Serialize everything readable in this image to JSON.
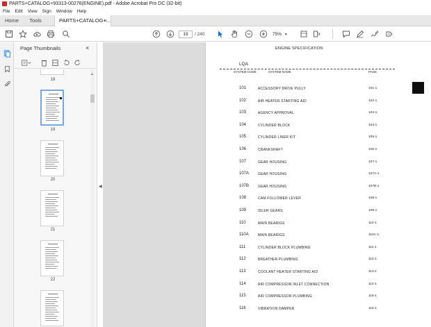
{
  "window": {
    "title": "PARTS+CATALOG+93313-00276(ENGINE).pdf - Adobe Acrobat Pro DC (32-bit)"
  },
  "menu": [
    "File",
    "Edit",
    "View",
    "Sign",
    "Window",
    "Help"
  ],
  "tabs": {
    "home": "Home",
    "tools": "Tools",
    "document": "PARTS+CATALOG+...",
    "close": "×"
  },
  "toolbar": {
    "page_current": "19",
    "page_total": "/ 240",
    "zoom": "75%"
  },
  "panel": {
    "title": "Page Thumbnails",
    "close": "×"
  },
  "thumbnails": [
    {
      "label": "18"
    },
    {
      "label": "19",
      "selected": true
    },
    {
      "label": "20"
    },
    {
      "label": "21"
    },
    {
      "label": "22"
    },
    {
      "label": ""
    }
  ],
  "document": {
    "heading": "ENGINE SPECIFICATION",
    "subheading": "LQA",
    "columns": {
      "code": "SYSTEM CODE",
      "name": "SYSTEM NAME",
      "page": "PAGE"
    },
    "rows": [
      {
        "code": "101",
        "name": "ACCESSORY DRIVE PULLY",
        "page": "101-1"
      },
      {
        "code": "102",
        "name": "AIR HEATER STARTING AID",
        "page": "102-1"
      },
      {
        "code": "103",
        "name": "AGENCY APPROVAL",
        "page": "103-1"
      },
      {
        "code": "104",
        "name": "CYLINDER BLOCK",
        "page": "104-1"
      },
      {
        "code": "105",
        "name": "CYLINDER LINER KIT",
        "page": "105-1"
      },
      {
        "code": "106",
        "name": "CRANKSHAFT",
        "page": "106-1"
      },
      {
        "code": "107",
        "name": "GEAR HOUSING",
        "page": "107-1"
      },
      {
        "code": "107A",
        "name": "GEAR HOUSING",
        "page": "107A-1"
      },
      {
        "code": "107B",
        "name": "GEAR HOUSING",
        "page": "107B-1"
      },
      {
        "code": "108",
        "name": "CAM FOLLOWER LEVER",
        "page": "108-1"
      },
      {
        "code": "109",
        "name": "IDLER GEARS",
        "page": "109-1"
      },
      {
        "code": "110",
        "name": "MAIN BEARIGS",
        "page": "110-1"
      },
      {
        "code": "110A",
        "name": "MAIN BEARIGS",
        "page": "110A-1"
      },
      {
        "code": "111",
        "name": "CYLINDER BLOCK PLUMBING",
        "page": "111-1"
      },
      {
        "code": "112",
        "name": "BREATHER PLUMBING",
        "page": "112-1"
      },
      {
        "code": "113",
        "name": "COOLANT HEATER STARTING AID",
        "page": "113-1"
      },
      {
        "code": "114",
        "name": "AIR COMPRESSOR INLET CONNECTION",
        "page": "114-1"
      },
      {
        "code": "115",
        "name": "AIR COMPRESSOR PLUMBING",
        "page": "115-1"
      },
      {
        "code": "116",
        "name": "VIBRATION DAMPER",
        "page": "116-1"
      }
    ]
  },
  "colors": {
    "accent": "#1a73c8",
    "selection": "#7aa7e0",
    "pdf_red": "#d7261e"
  }
}
